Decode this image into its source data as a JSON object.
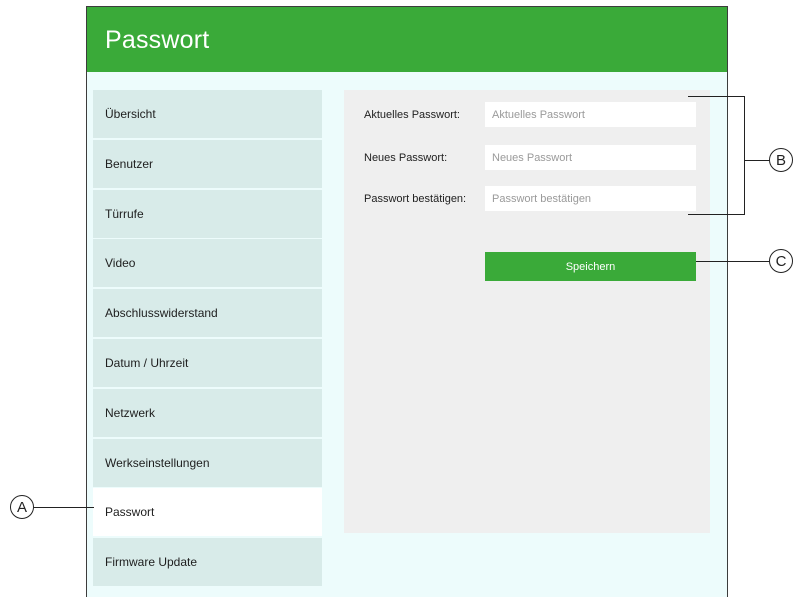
{
  "header": {
    "title": "Passwort"
  },
  "sidebar": {
    "items": [
      {
        "label": "Übersicht"
      },
      {
        "label": "Benutzer"
      },
      {
        "label": "Türrufe"
      },
      {
        "label": "Video"
      },
      {
        "label": "Abschlusswiderstand"
      },
      {
        "label": "Datum / Uhrzeit"
      },
      {
        "label": "Netzwerk"
      },
      {
        "label": "Werkseinstellungen"
      },
      {
        "label": "Passwort"
      },
      {
        "label": "Firmware Update"
      }
    ],
    "active": "Passwort"
  },
  "form": {
    "current": {
      "label": "Aktuelles Passwort:",
      "placeholder": "Aktuelles Passwort",
      "value": ""
    },
    "new": {
      "label": "Neues Passwort:",
      "placeholder": "Neues Passwort",
      "value": ""
    },
    "confirm": {
      "label": "Passwort bestätigen:",
      "placeholder": "Passwort bestätigen",
      "value": ""
    },
    "save_label": "Speichern"
  },
  "callouts": {
    "a": "A",
    "b": "B",
    "c": "C"
  },
  "colors": {
    "accent": "#3aaa39",
    "sidebar_item": "#d8ebe9",
    "panel": "#efefef",
    "window_bg": "#edfcfc"
  }
}
